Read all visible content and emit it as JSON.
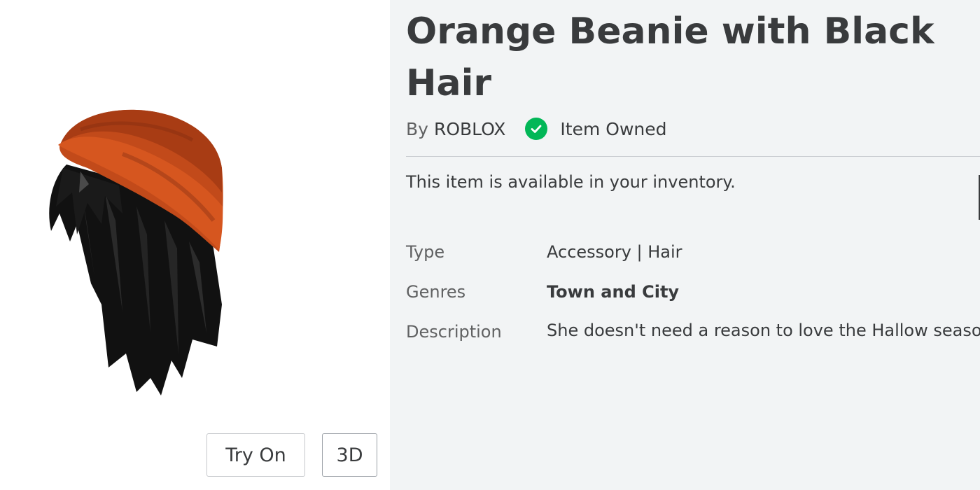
{
  "item": {
    "title": "Orange Beanie with Black Hair",
    "by_prefix": "By",
    "creator": "ROBLOX",
    "owned_label": "Item Owned",
    "availability": "This item is available in your inventory."
  },
  "thumbnail": {
    "try_on_label": "Try On",
    "view_3d_label": "3D"
  },
  "details": {
    "type_label": "Type",
    "type_value": "Accessory | Hair",
    "genres_label": "Genres",
    "genres_value": "Town and City",
    "description_label": "Description",
    "description_value": "She doesn't need a reason to love the Hallow season."
  },
  "icons": {
    "owned": "check-circle-icon"
  },
  "colors": {
    "owned_green": "#02b757",
    "beanie_orange": "#c24a1a",
    "text_primary": "#393b3d",
    "text_secondary": "#606162"
  }
}
